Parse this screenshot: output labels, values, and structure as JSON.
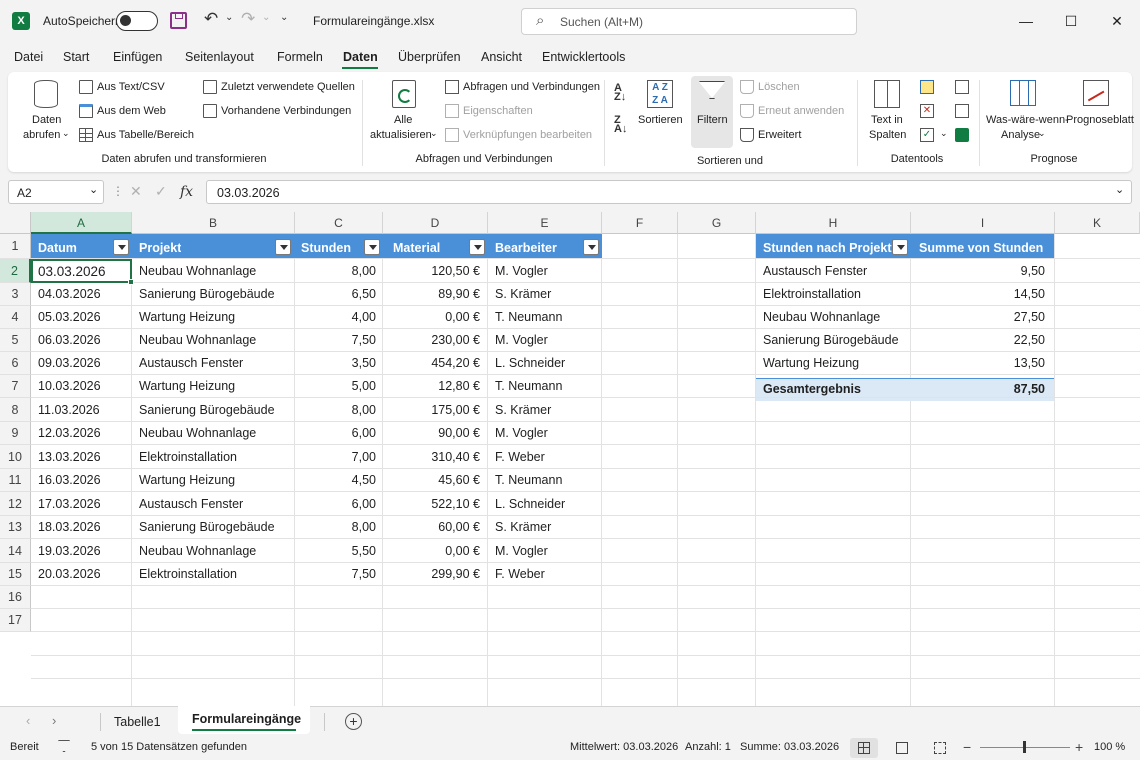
{
  "titlebar": {
    "autosave_label": "AutoSpeichern",
    "filename": "Formulareingänge.xlsx",
    "search_placeholder": "Suchen (Alt+M)"
  },
  "menu": [
    "Datei",
    "Start",
    "Einfügen",
    "Seitenlayout",
    "Formeln",
    "Daten",
    "Überprüfen",
    "Ansicht",
    "Entwicklertools"
  ],
  "menu_active": "Daten",
  "ribbon": {
    "daten_abrufen": [
      "Daten",
      "abrufen"
    ],
    "aus_text_csv": "Aus Text/CSV",
    "aus_dem_web": "Aus dem Web",
    "aus_tabelle": "Aus Tabelle/Bereich",
    "zuletzt": "Zuletzt verwendete Quellen",
    "vorhandene": "Vorhandene Verbindungen",
    "group1": "Daten abrufen und transformieren",
    "alle_aktualisieren": [
      "Alle",
      "aktualisieren"
    ],
    "abfragen_verbindungen": "Abfragen und Verbindungen",
    "eigenschaften": "Eigenschaften",
    "verknuepfungen": "Verknüpfungen bearbeiten",
    "group2": "Abfragen und Verbindungen",
    "sortieren": "Sortieren",
    "filtern": "Filtern",
    "loeschen": "Löschen",
    "erneut_anwenden": "Erneut anwenden",
    "erweitert": "Erweitert",
    "group3": "Sortieren und",
    "text_in_spalten": [
      "Text in",
      "Spalten"
    ],
    "group4": "Datentools",
    "was_waere_wenn": [
      "Was-wäre-wenn-",
      "Analyse"
    ],
    "prognoseblatt": "Prognoseblatt",
    "group5": "Prognose"
  },
  "formula": {
    "namebox": "A2",
    "fx": "fx",
    "value": "03.03.2026"
  },
  "columns": [
    "A",
    "B",
    "C",
    "D",
    "E",
    "F",
    "G",
    "H",
    "I",
    "K"
  ],
  "table_headers": [
    "Datum",
    "Projekt",
    "Stunden",
    "Material",
    "Bearbeiter"
  ],
  "rows": [
    [
      "03.03.2026",
      "Neubau Wohnanlage",
      "8,00",
      "120,50 €",
      "M. Vogler"
    ],
    [
      "04.03.2026",
      "Sanierung Bürogebäude",
      "6,50",
      "89,90 €",
      "S. Krämer"
    ],
    [
      "05.03.2026",
      "Wartung Heizung",
      "4,00",
      "0,00 €",
      "T. Neumann"
    ],
    [
      "06.03.2026",
      "Neubau Wohnanlage",
      "7,50",
      "230,00 €",
      "M. Vogler"
    ],
    [
      "09.03.2026",
      "Austausch Fenster",
      "3,50",
      "454,20 €",
      "L. Schneider"
    ],
    [
      "10.03.2026",
      "Wartung Heizung",
      "5,00",
      "12,80 €",
      "T. Neumann"
    ],
    [
      "11.03.2026",
      "Sanierung Bürogebäude",
      "8,00",
      "175,00 €",
      "S. Krämer"
    ],
    [
      "12.03.2026",
      "Neubau Wohnanlage",
      "6,00",
      "90,00 €",
      "M. Vogler"
    ],
    [
      "13.03.2026",
      "Elektroinstallation",
      "7,00",
      "310,40 €",
      "F. Weber"
    ],
    [
      "16.03.2026",
      "Wartung Heizung",
      "4,50",
      "45,60 €",
      "T. Neumann"
    ],
    [
      "17.03.2026",
      "Austausch Fenster",
      "6,00",
      "522,10 €",
      "L. Schneider"
    ],
    [
      "18.03.2026",
      "Sanierung Bürogebäude",
      "8,00",
      "60,00 €",
      "S. Krämer"
    ],
    [
      "19.03.2026",
      "Neubau Wohnanlage",
      "5,50",
      "0,00 €",
      "M. Vogler"
    ],
    [
      "20.03.2026",
      "Elektroinstallation",
      "7,50",
      "299,90 €",
      "F. Weber"
    ]
  ],
  "row_numbers": [
    "1",
    "2",
    "3",
    "4",
    "5",
    "6",
    "7",
    "8",
    "9",
    "10",
    "11",
    "12",
    "13",
    "14",
    "15",
    "16",
    "17"
  ],
  "pivot": {
    "header_label": "Stunden nach Projekt",
    "header_value": "Summe von Stunden",
    "rows": [
      [
        "Austausch Fenster",
        "9,50"
      ],
      [
        "Elektroinstallation",
        "14,50"
      ],
      [
        "Neubau Wohnanlage",
        "27,50"
      ],
      [
        "Sanierung Bürogebäude",
        "22,50"
      ],
      [
        "Wartung Heizung",
        "13,50"
      ]
    ],
    "total_label": "Gesamtergebnis",
    "total_value": "87,50"
  },
  "sheets": [
    "Tabelle1",
    "Formulareingänge"
  ],
  "active_sheet": "Formulareingänge",
  "status": {
    "ready": "Bereit",
    "filter_info": "5 von 15 Datensätzen gefunden",
    "mittelwert": "Mittelwert: 03.03.2026",
    "anzahl": "Anzahl: 1",
    "summe": "Summe: 03.03.2026",
    "zoom": "100 %"
  },
  "colors": {
    "accent": "#107c41",
    "table_header": "#4a90d9",
    "pivot_total": "#dbe9f7"
  }
}
